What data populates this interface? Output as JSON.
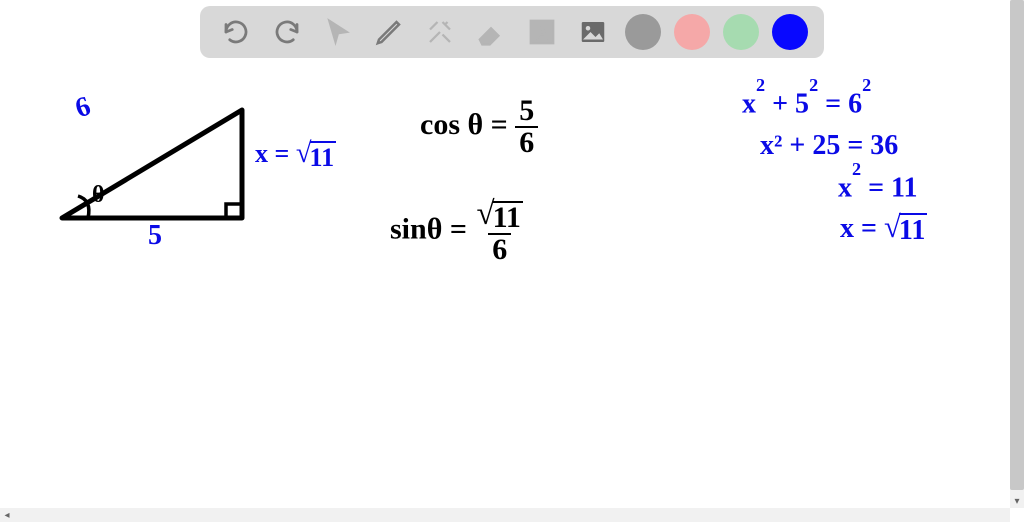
{
  "toolbar": {
    "icons": {
      "undo": "undo",
      "redo": "redo",
      "pointer": "pointer",
      "pencil": "pencil",
      "tools": "tools",
      "eraser": "eraser",
      "text": "A",
      "image": "image"
    },
    "colors": {
      "gray": "#9a9a9a",
      "pink": "#f5a8a8",
      "green": "#a6dbb0",
      "blue": "#0808ff"
    }
  },
  "triangle": {
    "hypotenuse_label": "6",
    "base_label": "5",
    "angle_label": "θ",
    "side_x_label": "x =",
    "side_x_value": "11"
  },
  "equations": {
    "cos": {
      "lhs": "cos θ =",
      "num": "5",
      "den": "6"
    },
    "sin": {
      "lhs": "sinθ =",
      "num_rad": "11",
      "den": "6"
    },
    "pyth1": "x² + 5² = 6²",
    "pyth2": "x² + 25 = 36",
    "pyth3": "x² = 11",
    "pyth4_lhs": "x =",
    "pyth4_rad": "11"
  }
}
